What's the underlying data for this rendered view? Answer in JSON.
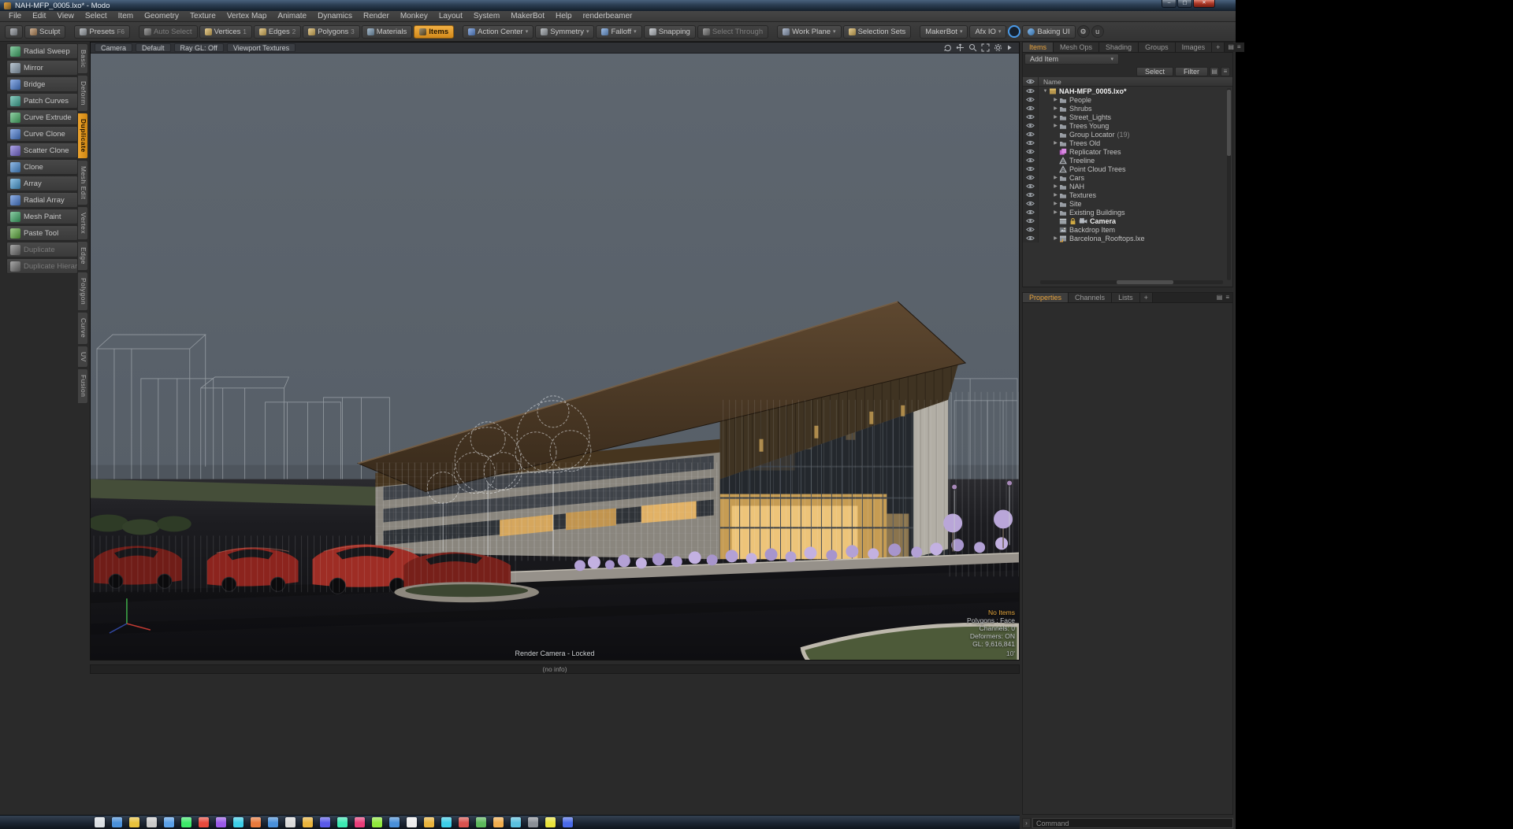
{
  "window": {
    "title": "NAH-MFP_0005.lxo* - Modo"
  },
  "menu_bar": [
    "File",
    "Edit",
    "View",
    "Select",
    "Item",
    "Geometry",
    "Texture",
    "Vertex Map",
    "Animate",
    "Dynamics",
    "Render",
    "Monkey",
    "Layout",
    "System",
    "MakerBot",
    "Help",
    "renderbeamer"
  ],
  "toolbar": {
    "buttons": [
      {
        "icon": "layout-grid",
        "icon_only": true,
        "icon_color": "#8f949b"
      },
      {
        "label": "Sculpt",
        "icon": "sculpt",
        "icon_color": "#b5875a"
      },
      {
        "label": "Presets",
        "shortcut": "F6",
        "icon": "presets",
        "icon_color": "#9aa0a6",
        "sep": true
      },
      {
        "label": "Auto Select",
        "state": "disabled",
        "icon": "auto-select",
        "icon_color": "#707070",
        "sep": true
      },
      {
        "label": "Vertices",
        "shortcut": "1",
        "icon": "vertices",
        "icon_color": "#d9b35a"
      },
      {
        "label": "Edges",
        "shortcut": "2",
        "icon": "edges",
        "icon_color": "#d9b35a"
      },
      {
        "label": "Polygons",
        "shortcut": "3",
        "icon": "polygons",
        "icon_color": "#d9b35a"
      },
      {
        "label": "Materials",
        "icon": "materials",
        "icon_color": "#7a9ab5"
      },
      {
        "label": "Items",
        "state": "active",
        "icon": "items",
        "icon_color": "#6a5426"
      },
      {
        "label": "Action Center",
        "dropdown": true,
        "icon": "action-center",
        "icon_color": "#5a8ad9",
        "sep": true
      },
      {
        "label": "Symmetry",
        "dropdown": true,
        "icon": "symmetry",
        "icon_color": "#9aa0a6"
      },
      {
        "label": "Falloff",
        "dropdown": true,
        "icon": "falloff",
        "icon_color": "#6a9ad9"
      },
      {
        "label": "Snapping",
        "icon": "snapping",
        "icon_color": "#b5bac0"
      },
      {
        "label": "Select Through",
        "state": "disabled",
        "icon": "select-through",
        "icon_color": "#707070"
      },
      {
        "label": "Work Plane",
        "dropdown": true,
        "icon": "work-plane",
        "icon_color": "#8a9ab5",
        "sep": true
      },
      {
        "label": "Selection Sets",
        "icon": "selection-sets",
        "icon_color": "#d9b35a"
      },
      {
        "label": "MakerBot",
        "dropdown": true,
        "sep": true
      },
      {
        "label": "Afx IO",
        "dropdown": true
      },
      {
        "icon": "record-ring",
        "icon_only": true,
        "circle": "ring"
      },
      {
        "label": "Baking UI",
        "icon": "baking",
        "icon_color": "#4a9ae8",
        "icon_round": true
      },
      {
        "icon": "gear",
        "icon_only": true,
        "circle": "dark",
        "glyph": "⚙"
      },
      {
        "icon": "renderbeamer",
        "icon_only": true,
        "circle": "dark",
        "glyph": "u"
      }
    ]
  },
  "tool_tabs": [
    {
      "label": "Basic"
    },
    {
      "label": "Deform"
    },
    {
      "label": "Duplicate",
      "active": true
    },
    {
      "label": "Mesh Edit"
    },
    {
      "label": "Vertex"
    },
    {
      "label": "Edge"
    },
    {
      "label": "Polygon"
    },
    {
      "label": "Curve"
    },
    {
      "label": "UV"
    },
    {
      "label": "Fusion"
    }
  ],
  "tool_palette": {
    "tools": [
      {
        "label": "Radial Sweep",
        "icon_color": "#3fae6a"
      },
      {
        "label": "Mirror",
        "icon_color": "#8fa3b5"
      },
      {
        "label": "Bridge",
        "icon_color": "#4a7fd9"
      },
      {
        "label": "Patch Curves",
        "icon_color": "#3fae9a"
      },
      {
        "label": "Curve Extrude",
        "icon_color": "#49b56a"
      },
      {
        "label": "Curve Clone",
        "icon_color": "#4a7fd9"
      },
      {
        "label": "Scatter Clone",
        "icon_color": "#7a6ad9"
      },
      {
        "label": "Clone",
        "icon_color": "#4a8fd9"
      },
      {
        "label": "Array",
        "icon_color": "#4a9fd9"
      },
      {
        "label": "Radial Array",
        "icon_color": "#4a7fd9"
      },
      {
        "label": "Mesh Paint",
        "icon_color": "#3fae6a"
      },
      {
        "label": "Paste Tool",
        "icon_color": "#5fae3f"
      },
      {
        "label": "Duplicate",
        "disabled": true,
        "icon_color": "#6f6f6f"
      },
      {
        "label": "Duplicate Hierarchy",
        "disabled": true,
        "icon_color": "#6f6f6f"
      }
    ]
  },
  "viewport": {
    "header": {
      "camera": "Camera",
      "style": "Default",
      "ray_gl": "Ray GL: Off",
      "textures": "Viewport Textures"
    },
    "overlay": {
      "camera_status": "Render Camera - Locked",
      "info_bar": "(no info)",
      "stats": [
        "No Items",
        "Polygons : Face",
        "Channels: 0",
        "Deformers: ON",
        "GL: 9,616,841"
      ],
      "grid_size": "10'"
    }
  },
  "items_panel": {
    "tabs": [
      {
        "label": "Items",
        "active": true
      },
      {
        "label": "Mesh Ops"
      },
      {
        "label": "Shading"
      },
      {
        "label": "Groups"
      },
      {
        "label": "Images"
      },
      {
        "label": "+"
      }
    ],
    "add_item_label": "Add Item",
    "select_label": "Select",
    "filter_label": "Filter",
    "name_header": "Name",
    "rows": [
      {
        "label": "NAH-MFP_0005.lxo*",
        "icon": "scene",
        "bold": true,
        "expander": "open",
        "indent": 0
      },
      {
        "label": "People",
        "icon": "group",
        "expander": "closed",
        "indent": 1
      },
      {
        "label": "Shrubs",
        "icon": "group",
        "expander": "closed",
        "indent": 1
      },
      {
        "label": "Street_Lights",
        "icon": "group",
        "expander": "closed",
        "indent": 1
      },
      {
        "label": "Trees Young",
        "icon": "group",
        "expander": "closed",
        "indent": 1
      },
      {
        "label": "Group Locator",
        "suffix": "(19)",
        "icon": "group",
        "expander": "none",
        "indent": 1
      },
      {
        "label": "Trees Old",
        "icon": "group",
        "expander": "closed",
        "indent": 1
      },
      {
        "label": "Replicator Trees",
        "icon": "replicator",
        "expander": "none",
        "indent": 1
      },
      {
        "label": "Treeline",
        "icon": "mesh",
        "expander": "none",
        "indent": 1
      },
      {
        "label": "Point Cloud Trees",
        "icon": "mesh",
        "expander": "none",
        "indent": 1
      },
      {
        "label": "Cars",
        "icon": "group",
        "expander": "closed",
        "indent": 1
      },
      {
        "label": "NAH",
        "icon": "group",
        "expander": "closed",
        "indent": 1
      },
      {
        "label": "Textures",
        "icon": "group",
        "expander": "closed",
        "indent": 1
      },
      {
        "label": "Site",
        "icon": "group",
        "expander": "closed",
        "indent": 1
      },
      {
        "label": "Existing Buildings",
        "icon": "group",
        "expander": "closed",
        "indent": 1
      },
      {
        "label": "Camera",
        "icon": "camera",
        "bold": true,
        "expander": "none",
        "indent": 1,
        "extra_icons": [
          "render-camera",
          "lock"
        ]
      },
      {
        "label": "Backdrop Item",
        "icon": "backdrop",
        "expander": "none",
        "indent": 1
      },
      {
        "label": "Barcelona_Rooftops.lxe",
        "icon": "scene-ref",
        "expander": "closed",
        "indent": 1
      }
    ]
  },
  "properties_panel": {
    "tabs": [
      {
        "label": "Properties",
        "active": true
      },
      {
        "label": "Channels"
      },
      {
        "label": "Lists"
      },
      {
        "label": "+"
      }
    ]
  },
  "command_bar": {
    "placeholder": "Command"
  },
  "colors": {
    "accent_orange": "#e8982a",
    "viewport_sky": "#5a626b",
    "roof_brown": "#4a3827",
    "glass_lit": "#d8a958",
    "shrub_purple": "#b4a2d6",
    "car_red": "#8c241e"
  },
  "taskbar": {
    "icon_colors": [
      "#d9dde2",
      "#4a90d9",
      "#e8c23d",
      "#c9c9c9",
      "#5aa0e8",
      "#3de86a",
      "#e84a3d",
      "#9a5ae8",
      "#3dcee8",
      "#e87a3d",
      "#4a90d9",
      "#d9d9d9",
      "#e8b33d",
      "#5a5ae8",
      "#3de8b3",
      "#e83d7a",
      "#90e83d",
      "#4a90d9",
      "#ececec",
      "#e8b33d",
      "#3dcee8",
      "#d9534f",
      "#5cb85c",
      "#f0ad4e",
      "#5bc0de",
      "#8a8f96",
      "#e8e23d",
      "#4a6ae8"
    ]
  }
}
